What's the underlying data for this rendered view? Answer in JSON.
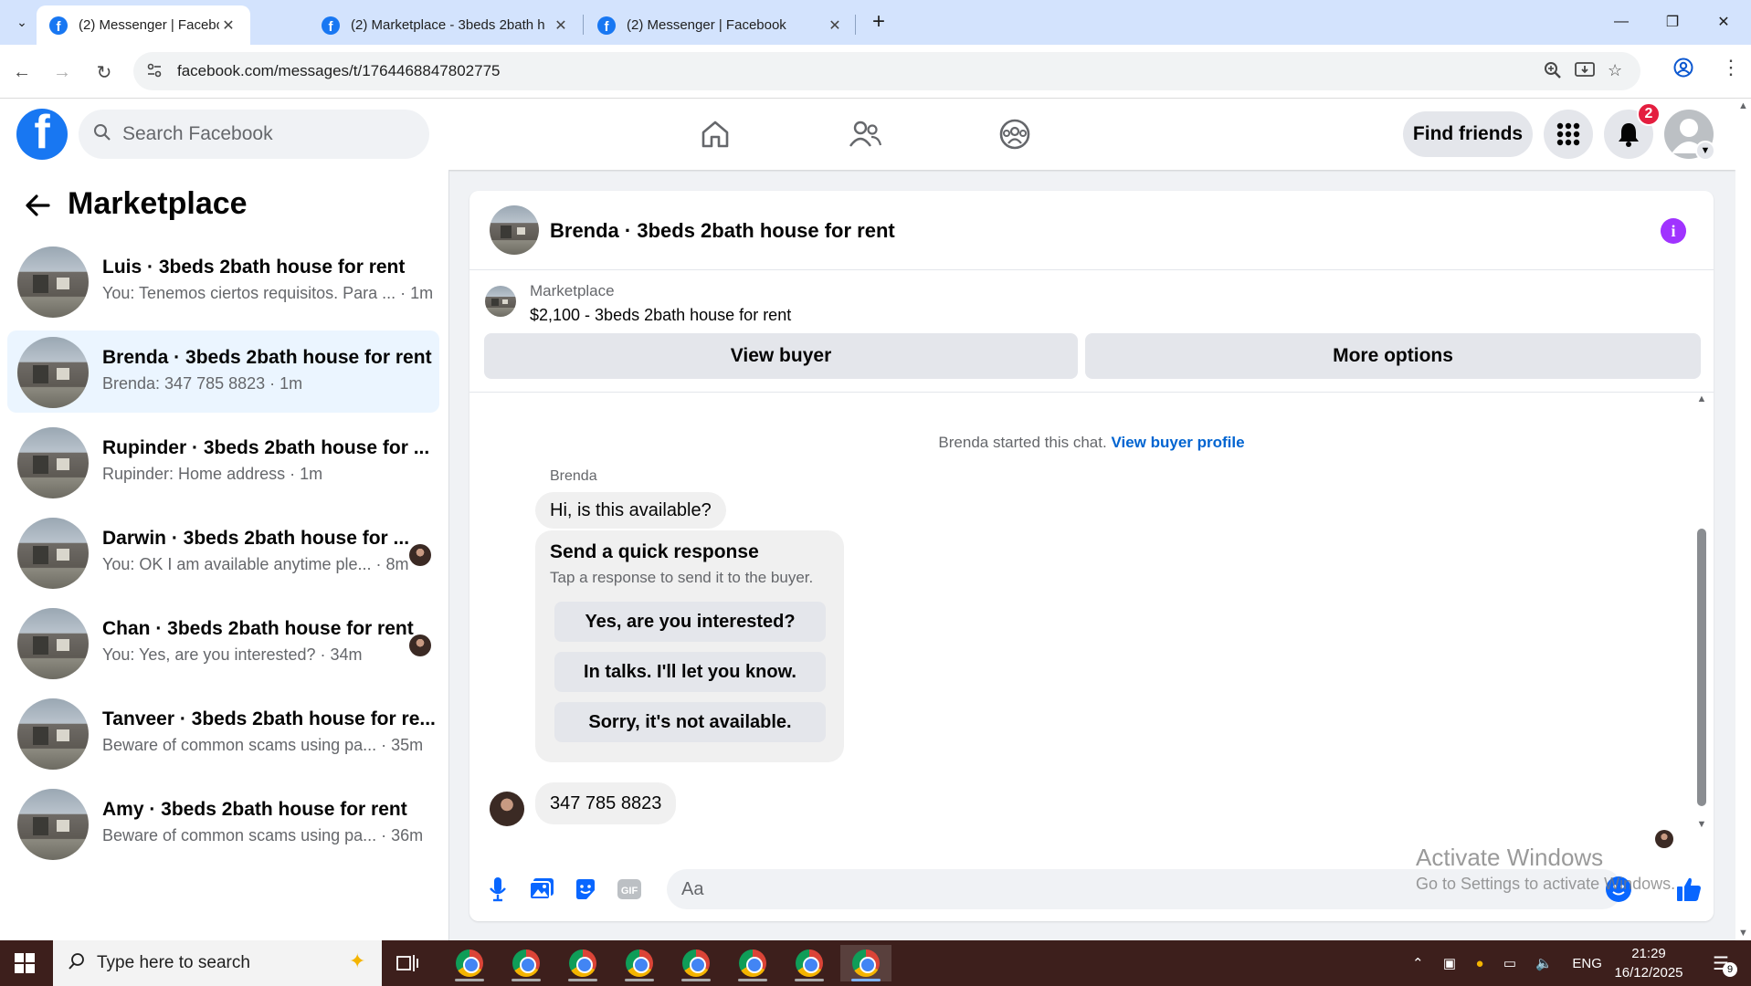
{
  "browser": {
    "tabs": [
      {
        "title": "(2) Messenger | Facebook",
        "active": true
      },
      {
        "title": "(2) Marketplace - 3beds 2bath h",
        "active": false
      },
      {
        "title": "(2) Messenger | Facebook",
        "active": false
      }
    ],
    "url": "facebook.com/messages/t/1764468847802775"
  },
  "fb_header": {
    "search_placeholder": "Search Facebook",
    "find_friends_label": "Find friends",
    "notification_count": "2"
  },
  "sidebar": {
    "title": "Marketplace",
    "conversations": [
      {
        "name": "Luis · 3beds 2bath house for rent",
        "snippet": "You: Tenemos ciertos requisitos. Para ... · 1m",
        "selected": false
      },
      {
        "name": "Brenda · 3beds 2bath house for rent",
        "snippet": "Brenda: 347 785 8823 · 1m",
        "selected": true
      },
      {
        "name": "Rupinder · 3beds 2bath house for ...",
        "snippet": "Rupinder: Home address · 1m",
        "selected": false
      },
      {
        "name": "Darwin · 3beds 2bath house for ...",
        "snippet": "You: OK I am available anytime ple... · 8m",
        "selected": false
      },
      {
        "name": "Chan · 3beds 2bath house for rent",
        "snippet": "You: Yes, are you interested? · 34m",
        "selected": false
      },
      {
        "name": "Tanveer · 3beds 2bath house for re...",
        "snippet": "Beware of common scams using pa... · 35m",
        "selected": false
      },
      {
        "name": "Amy · 3beds 2bath house for rent",
        "snippet": "Beware of common scams using pa... · 36m",
        "selected": false
      }
    ]
  },
  "chat": {
    "title": "Brenda · 3beds 2bath house for rent",
    "listing_label": "Marketplace",
    "listing_price_title": "$2,100 - 3beds 2bath house for rent",
    "view_buyer_label": "View buyer",
    "more_options_label": "More options",
    "started_text": "Brenda started this chat.",
    "view_buyer_profile_label": "View buyer profile",
    "sender_name": "Brenda",
    "first_message": "Hi, is this available?",
    "quick_response_title": "Send a quick response",
    "quick_response_sub": "Tap a response to send it to the buyer.",
    "quick_responses": [
      "Yes, are you interested?",
      "In talks. I'll let you know.",
      "Sorry, it's not available."
    ],
    "last_message": "347 785 8823",
    "composer_placeholder": "Aa",
    "gif_label": "GIF"
  },
  "watermark": {
    "line1": "Activate Windows",
    "line2": "Go to Settings to activate Windows."
  },
  "taskbar": {
    "search_placeholder": "Type here to search",
    "language": "ENG",
    "time": "21:29",
    "date": "16/12/2025",
    "notification_count": "9"
  },
  "colors": {
    "fb_blue": "#1877f2",
    "messenger_blue": "#0866ff",
    "info_purple": "#a033ff",
    "selected_bg": "#ebf5ff",
    "taskbar": "#3d1f1c"
  }
}
